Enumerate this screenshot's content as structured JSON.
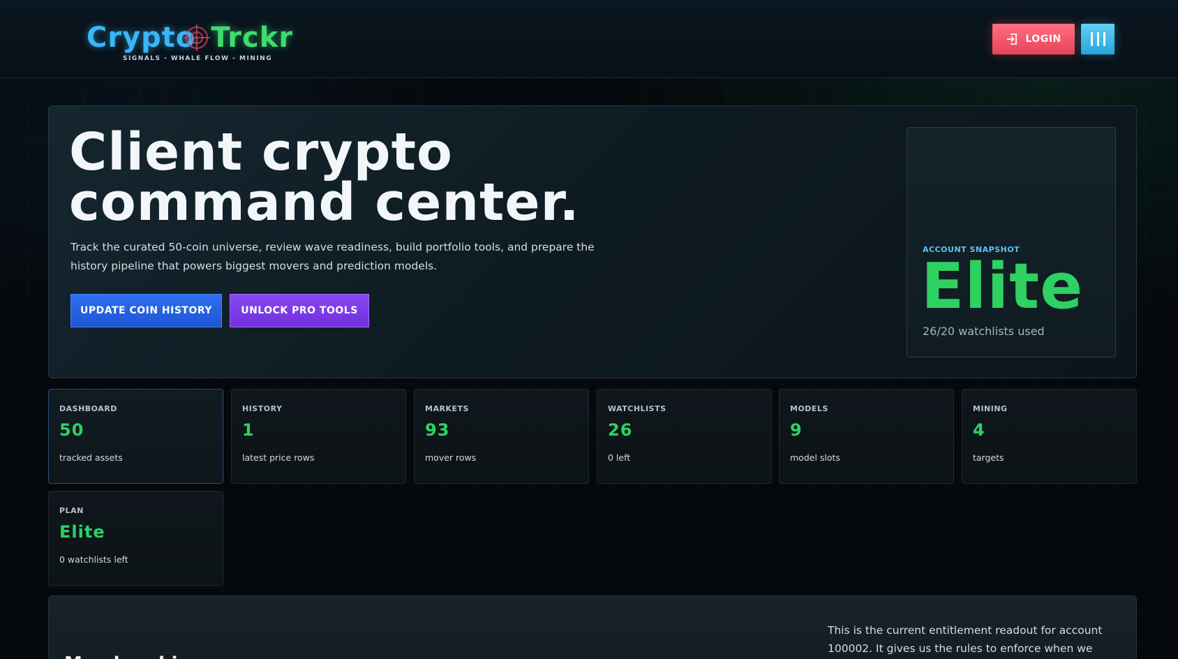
{
  "header": {
    "logo_part1": "Crypto",
    "logo_part2": "Trckr",
    "logo_tagline": "SIGNALS - WHALE FLOW - MINING",
    "login_label": "LOGIN"
  },
  "hero": {
    "title_line1": "Client crypto",
    "title_line2": "command center.",
    "description": "Track the curated 50-coin universe, review wave readiness, build portfolio tools, and prepare the history pipeline that powers biggest movers and prediction models.",
    "update_button": "UPDATE COIN HISTORY",
    "unlock_button": "UNLOCK PRO TOOLS"
  },
  "snapshot": {
    "label": "ACCOUNT SNAPSHOT",
    "plan": "Elite",
    "sub": "26/20 watchlists used"
  },
  "stats": [
    {
      "label": "DASHBOARD",
      "value": "50",
      "sub": "tracked assets"
    },
    {
      "label": "HISTORY",
      "value": "1",
      "sub": "latest price rows"
    },
    {
      "label": "MARKETS",
      "value": "93",
      "sub": "mover rows"
    },
    {
      "label": "WATCHLISTS",
      "value": "26",
      "sub": "0 left"
    },
    {
      "label": "MODELS",
      "value": "9",
      "sub": "model slots"
    },
    {
      "label": "MINING",
      "value": "4",
      "sub": "targets"
    },
    {
      "label": "PLAN",
      "value": "Elite",
      "sub": "0 watchlists left"
    }
  ],
  "bottom": {
    "heading": "Membership",
    "description": "This is the current entitlement readout for account 100002. It gives us the rules to enforce when we build watchlist"
  },
  "colors": {
    "accent_green": "#2ed162",
    "accent_blue": "#38b6f5",
    "login_pink": "#e84358",
    "update_blue": "#1f55d4",
    "unlock_purple": "#6f30de"
  }
}
